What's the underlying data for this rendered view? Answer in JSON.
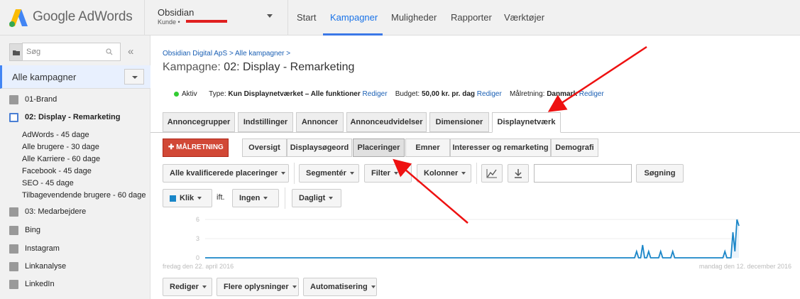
{
  "header": {
    "logo_text": "Google AdWords",
    "account_name": "Obsidian",
    "account_sub": "Kunde  •",
    "nav": [
      "Start",
      "Kampagner",
      "Muligheder",
      "Rapporter",
      "Værktøjer"
    ],
    "active_nav": "Kampagner"
  },
  "sidebar": {
    "search_placeholder": "Søg",
    "collapse_glyph": "«",
    "all_campaigns": "Alle kampagner",
    "items": [
      {
        "label": "01-Brand"
      },
      {
        "label": "02: Display - Remarketing"
      },
      {
        "label": "03: Medarbejdere"
      },
      {
        "label": "Bing"
      },
      {
        "label": "Instagram"
      },
      {
        "label": "Linkanalyse"
      },
      {
        "label": "LinkedIn"
      }
    ],
    "sub_items": [
      "AdWords - 45 dage",
      "Alle brugere - 30 dage",
      "Alle Karriere - 60 dage",
      "Facebook - 45 dage",
      "SEO - 45 dage",
      "Tilbagevendende brugere - 60 dage"
    ]
  },
  "main": {
    "breadcrumb": "Obsidian Digital ApS > Alle kampagner >",
    "title_label": "Kampagne:",
    "title_value": "02: Display - Remarketing",
    "status": "Aktiv",
    "type_label": "Type:",
    "type_value": "Kun Displaynetværket – Alle funktioner",
    "edit": "Rediger",
    "budget_label": "Budget:",
    "budget_value": "50,00 kr. pr. dag",
    "target_label": "Målretning:",
    "target_value": "Danmark",
    "tabs": [
      "Annoncegrupper",
      "Indstillinger",
      "Annoncer",
      "Annonceudvidelser",
      "Dimensioner",
      "Displaynetværk"
    ],
    "active_tab": "Displaynetværk",
    "targeting_button": "MÅLRETNING",
    "subtabs": [
      "Oversigt",
      "Displaysøgeord",
      "Placeringer",
      "Emner",
      "Interesser og remarketing",
      "Demografi"
    ],
    "active_subtab": "Placeringer",
    "filters": {
      "placements": "Alle kvalificerede placeringer",
      "segment": "Segmentér",
      "filter": "Filter",
      "columns": "Kolonner",
      "search_button": "Søgning"
    },
    "metric1": "Klik",
    "vs": "ift.",
    "metric2": "Ingen",
    "period": "Dagligt",
    "bottom_buttons": [
      "Rediger",
      "Flere oplysninger",
      "Automatisering"
    ]
  },
  "chart_data": {
    "type": "line",
    "x_start_label": "fredag den 22. april 2016",
    "x_end_label": "mandag den 12. december 2016",
    "yticks": [
      "6",
      "3",
      "0"
    ],
    "ylim": [
      0,
      6
    ],
    "color": "#1a86c8",
    "series": [
      {
        "values": [
          0,
          0,
          0,
          0,
          0,
          0,
          0,
          0,
          0,
          0,
          0,
          0,
          0,
          0,
          0,
          0,
          0,
          0,
          0,
          0,
          0,
          0,
          0,
          0,
          0,
          0,
          0,
          0,
          0,
          0,
          0,
          0,
          0,
          0,
          0,
          0,
          0,
          0,
          0,
          0,
          0,
          0,
          0,
          0,
          0,
          0,
          0,
          0,
          0,
          0,
          0,
          0,
          0,
          0,
          0,
          0,
          0,
          0,
          0,
          0,
          0,
          0,
          0,
          0,
          0,
          0,
          0,
          0,
          0,
          0,
          0,
          0,
          0,
          0,
          0,
          0,
          0,
          0,
          0,
          0,
          0,
          0,
          0,
          0,
          0,
          0,
          0,
          0,
          0,
          0,
          0,
          0,
          0,
          0,
          0,
          0,
          0,
          0,
          0,
          0,
          0,
          0,
          0,
          0,
          0,
          0,
          0,
          0,
          0,
          0,
          0,
          0,
          0,
          0,
          0,
          0,
          0,
          0,
          0,
          0,
          0,
          0,
          0,
          0,
          0,
          0,
          0,
          0,
          0,
          0,
          0,
          0,
          0,
          0,
          0,
          0,
          0,
          0,
          0,
          0,
          0,
          0,
          0,
          0,
          0,
          0,
          0,
          0,
          0,
          0,
          0,
          0,
          0,
          0,
          0,
          0,
          0,
          0,
          0,
          0,
          0,
          0,
          0,
          0,
          0,
          0,
          0,
          0,
          0,
          0,
          0,
          0,
          0,
          0,
          0,
          0,
          0,
          0,
          0,
          0,
          0,
          0,
          0,
          0,
          0,
          0,
          0,
          0,
          0,
          0,
          0,
          0,
          0,
          0,
          0,
          0,
          0,
          0,
          0,
          0,
          0,
          0,
          0,
          0,
          0,
          0,
          0,
          0,
          0,
          0,
          0,
          0,
          0,
          0,
          0,
          1,
          0,
          0,
          2,
          0,
          0,
          1,
          0,
          0,
          0,
          0,
          0,
          1,
          0,
          0,
          0,
          0,
          0,
          1,
          0,
          0,
          0,
          0,
          0,
          0,
          0,
          0,
          0,
          0,
          0,
          0,
          0,
          0,
          0,
          0,
          0,
          0,
          0,
          0,
          0,
          0,
          0,
          0,
          0,
          1,
          0,
          0,
          0,
          4,
          1,
          6,
          5
        ]
      }
    ]
  }
}
